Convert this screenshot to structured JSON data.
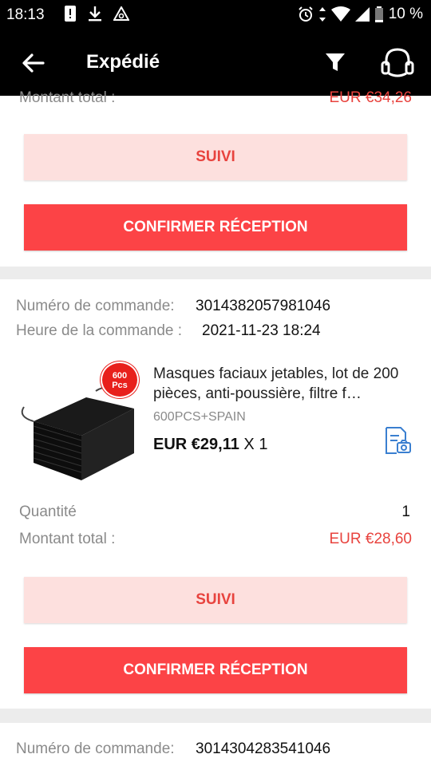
{
  "status_bar": {
    "time": "18:13",
    "battery": "10 %"
  },
  "app_bar": {
    "title": "Expédié"
  },
  "colors": {
    "accent": "#fc4346",
    "accent_light": "#fde0de",
    "price_red": "#e8433e"
  },
  "order_prev": {
    "total_label": "Montant total :",
    "total_value": "EUR €34,26",
    "track_label": "SUIVI",
    "confirm_label": "CONFIRMER RÉCEPTION"
  },
  "order": {
    "number_label": "Numéro de commande:",
    "number_value": "3014382057981046",
    "time_label": "Heure de la commande :",
    "time_value": "2021-11-23 18:24",
    "badge_top": "600",
    "badge_bottom": "Pcs",
    "product_title": "Masques faciaux jetables, lot de 200 pièces, anti-poussière, filtre f…",
    "variant": "600PCS+SPAIN",
    "price": "EUR €29,11",
    "qty_suffix": "X 1",
    "quantity_label": "Quantité",
    "quantity_value": "1",
    "total_label": "Montant total :",
    "total_value": "EUR €28,60",
    "track_label": "SUIVI",
    "confirm_label": "CONFIRMER RÉCEPTION"
  },
  "order_next": {
    "number_label": "Numéro de commande:",
    "number_value": "3014304283541046"
  }
}
